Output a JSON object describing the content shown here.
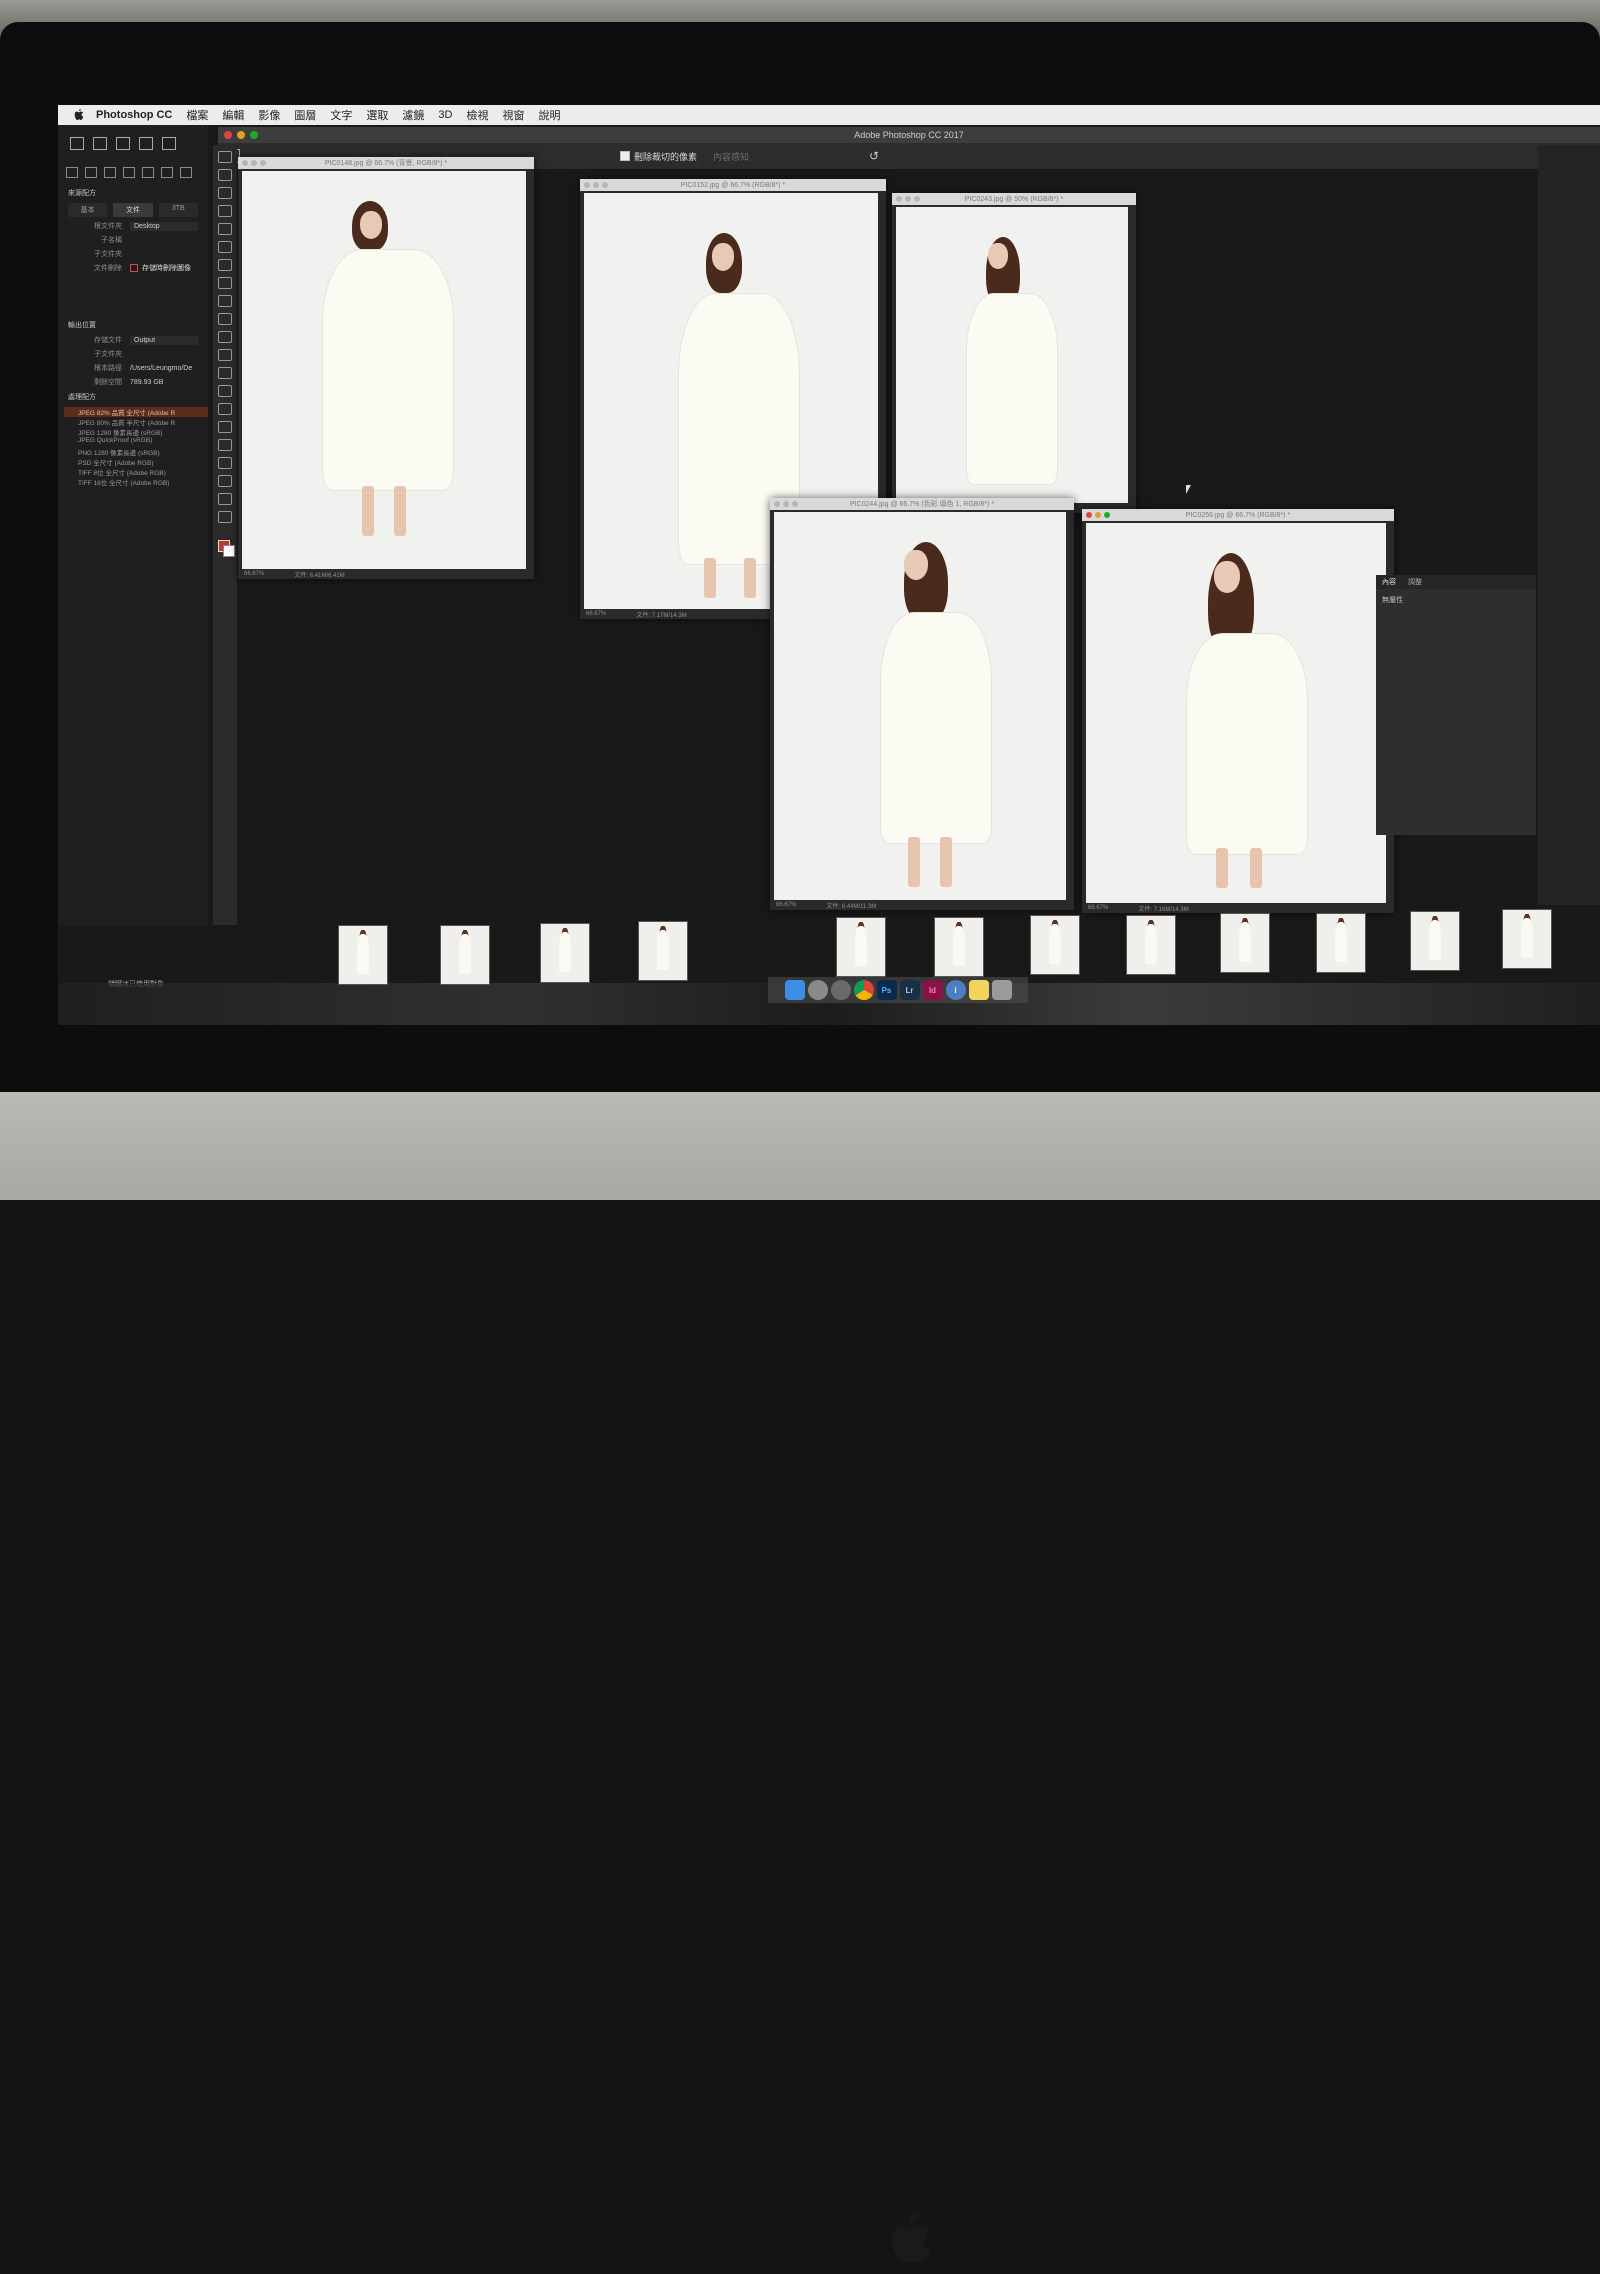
{
  "menubar": {
    "app_name": "Photoshop CC",
    "items": [
      "檔案",
      "編輯",
      "影像",
      "圖層",
      "文字",
      "選取",
      "濾鏡",
      "3D",
      "檢視",
      "視窗",
      "說明"
    ]
  },
  "window_title": "Adobe Photoshop CC 2017",
  "options_bar": {
    "checkbox_label": "刪除裁切的像素",
    "dim_label": "內容感知"
  },
  "left_panel": {
    "section_source": "來源配方",
    "tabs": [
      "基本",
      "文件",
      "3TB"
    ],
    "source_rows": [
      {
        "key": "根文件夾",
        "value": "Desktop"
      },
      {
        "key": "子名稱",
        "value": ""
      },
      {
        "key": "子文件夾",
        "value": ""
      },
      {
        "key": "文件刪除",
        "value": "存儲時刪除圖像"
      }
    ],
    "section_output": "輸出位置",
    "output_rows": [
      {
        "key": "存儲文件",
        "value": "Output"
      },
      {
        "key": "子文件夾",
        "value": ""
      },
      {
        "key": "根本路徑",
        "value": "/Users/Leungmo/De"
      },
      {
        "key": "剩餘空間",
        "value": "789.93 GB"
      }
    ],
    "section_presets": "處理配方",
    "presets": [
      "JPEG 82% 品質 全尺寸 (Adobe R",
      "JPEG 80% 品質 半尺寸 (Adobe R",
      "JPEG 1280 像素長邊 (sRGB)",
      "JPEG QuickProof (sRGB)",
      "PNG 1280 像素長邊 (sRGB)",
      "PSD 全尺寸 (Adobe RGB)",
      "TIFF 8位 全尺寸 (Adobe RGB)",
      "TIFF 16位 全尺寸 (Adobe RGB)"
    ],
    "footer": "儲臓冰已使用對象"
  },
  "documents": [
    {
      "title": "PIC0148.jpg @ 66.7% (背景, RGB/8*) *",
      "zoom": "66.67%",
      "file": "文件: 6.41M/6.41M"
    },
    {
      "title": "PIC0152.jpg @ 66.7% (RGB/8*) *",
      "zoom": "66.67%",
      "file": "文件: 7.17M/14.3M"
    },
    {
      "title": "PIC0243.jpg @ 50% (RGB/8*) *",
      "zoom": "",
      "file": ""
    },
    {
      "title": "PIC0244.jpg @ 66.7% (色彩 填色 1, RGB/8*) *",
      "zoom": "66.67%",
      "file": "文件: 6.44M/11.3M"
    },
    {
      "title": "PIC0256.jpg @ 66.7% (RGB/8*) *",
      "zoom": "66.67%",
      "file": "文件: 7.16M/14.3M"
    }
  ],
  "right_panel": {
    "tabs": [
      "內容",
      "調整"
    ],
    "body": "無屬性"
  },
  "dock": {
    "apps": [
      {
        "name": "finder-icon",
        "label": "",
        "color": "#3a8ee6"
      },
      {
        "name": "launchpad-icon",
        "label": "",
        "color": "#8a8a8a"
      },
      {
        "name": "rocket-icon",
        "label": "",
        "color": "#6a6a6a"
      },
      {
        "name": "chrome-icon",
        "label": "",
        "color": "#e8b42c"
      },
      {
        "name": "photoshop-icon",
        "label": "Ps",
        "color": "#0d2a4a"
      },
      {
        "name": "lightroom-icon",
        "label": "Lr",
        "color": "#1b2f44"
      },
      {
        "name": "indesign-icon",
        "label": "Id",
        "color": "#8a1048"
      },
      {
        "name": "info-icon",
        "label": "i",
        "color": "#4a7fc1"
      },
      {
        "name": "notes-icon",
        "label": "",
        "color": "#f2d45c"
      },
      {
        "name": "trash-icon",
        "label": "",
        "color": "#9a9a9a"
      }
    ]
  },
  "filmstrip_count": 12
}
